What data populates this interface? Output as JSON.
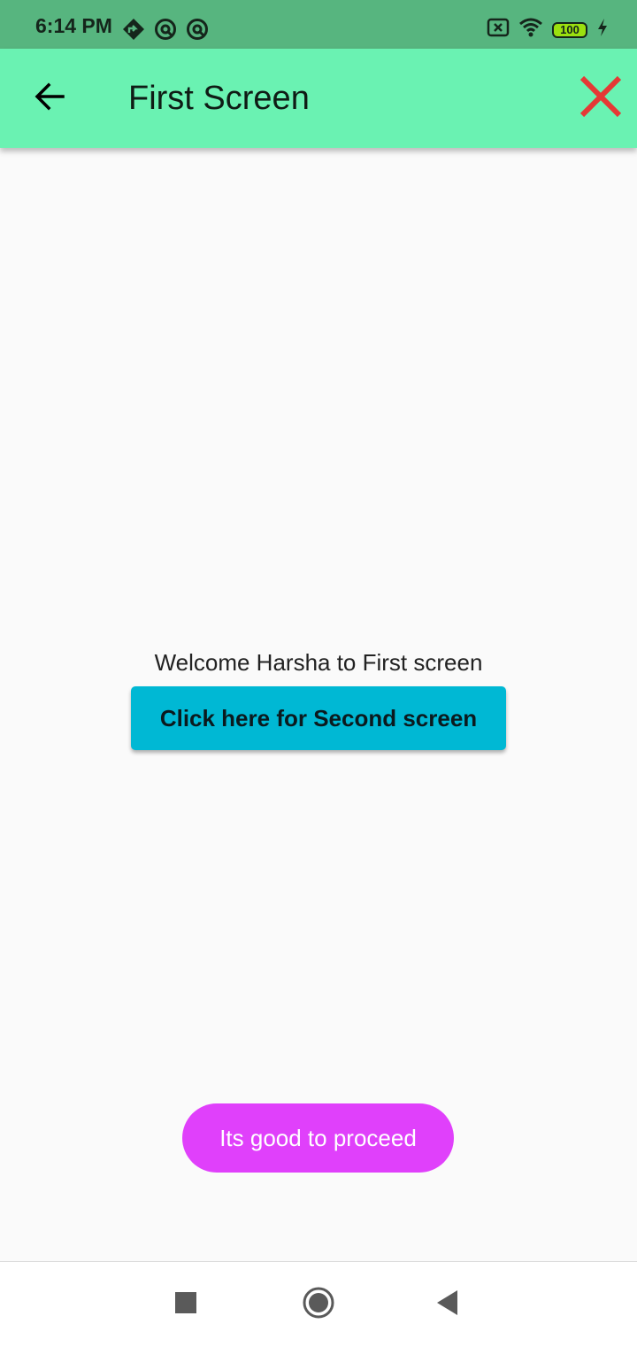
{
  "status_bar": {
    "time": "6:14 PM",
    "left_icons": [
      "map-icon",
      "circle-notification-icon",
      "circle-notification-icon"
    ],
    "right_icons": [
      "no-sim-icon",
      "wifi-icon",
      "battery-icon",
      "charging-icon"
    ],
    "battery_level": "100"
  },
  "app_bar": {
    "title": "First Screen",
    "back_icon": "arrow-left-icon",
    "close_icon": "close-icon",
    "background_color": "#6af2b2",
    "close_color": "#e53935"
  },
  "main": {
    "welcome_text": "Welcome Harsha to First screen",
    "button_label": "Click here for Second screen",
    "button_color": "#00b8d4"
  },
  "toast": {
    "message": "Its good to proceed",
    "color": "#e040fb"
  },
  "nav_bar": {
    "buttons": [
      "recents-square-icon",
      "home-circle-icon",
      "back-triangle-icon"
    ]
  }
}
